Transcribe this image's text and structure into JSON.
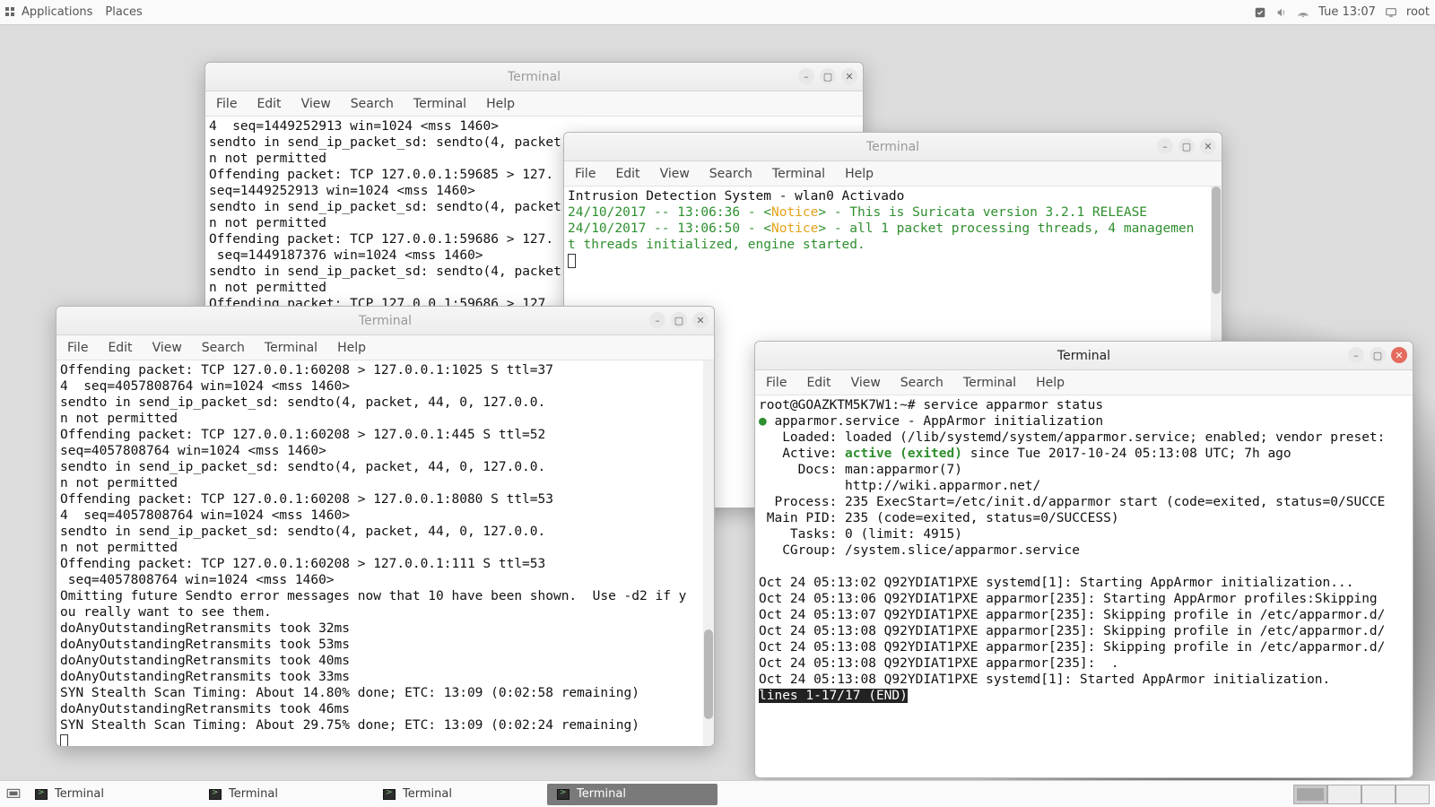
{
  "top": {
    "applications": "Applications",
    "places": "Places",
    "clock": "Tue 13:07",
    "user": "root"
  },
  "bottom": {
    "tasks": [
      "Terminal",
      "Terminal",
      "Terminal",
      "Terminal"
    ],
    "active_index": 3
  },
  "menus": {
    "file": "File",
    "edit": "Edit",
    "view": "View",
    "search": "Search",
    "terminal": "Terminal",
    "help": "Help"
  },
  "win1": {
    "title": "Terminal",
    "body": "4  seq=1449252913 win=1024 <mss 1460>\nsendto in send_ip_packet_sd: sendto(4, packet\nn not permitted\nOffending packet: TCP 127.0.0.1:59685 > 127.\nseq=1449252913 win=1024 <mss 1460>\nsendto in send_ip_packet_sd: sendto(4, packet\nn not permitted\nOffending packet: TCP 127.0.0.1:59686 > 127.\n seq=1449187376 win=1024 <mss 1460>\nsendto in send_ip_packet_sd: sendto(4, packet\nn not permitted\nOffending packet: TCP 127.0.0.1:59686 > 127."
  },
  "win2": {
    "title": "Terminal",
    "line0": "Intrusion Detection System - wlan0 Activado",
    "ts1": "24/10/2017 -- 13:06:36 - <",
    "ts2": "24/10/2017 -- 13:06:50 - <",
    "notice": "Notice",
    "msg1": "This is Suricata version 3.2.1 RELEASE",
    "msg2a": "all 1 packet processing threads, 4 managemen",
    "msg2b": "t threads initialized, engine started."
  },
  "win3": {
    "title": "Terminal",
    "body": "Offending packet: TCP 127.0.0.1:60208 > 127.0.0.1:1025 S ttl=37\n4  seq=4057808764 win=1024 <mss 1460>\nsendto in send_ip_packet_sd: sendto(4, packet, 44, 0, 127.0.0.\nn not permitted\nOffending packet: TCP 127.0.0.1:60208 > 127.0.0.1:445 S ttl=52\nseq=4057808764 win=1024 <mss 1460>\nsendto in send_ip_packet_sd: sendto(4, packet, 44, 0, 127.0.0.\nn not permitted\nOffending packet: TCP 127.0.0.1:60208 > 127.0.0.1:8080 S ttl=53\n4  seq=4057808764 win=1024 <mss 1460>\nsendto in send_ip_packet_sd: sendto(4, packet, 44, 0, 127.0.0.\nn not permitted\nOffending packet: TCP 127.0.0.1:60208 > 127.0.0.1:111 S ttl=53\n seq=4057808764 win=1024 <mss 1460>\nOmitting future Sendto error messages now that 10 have been shown.  Use -d2 if y\nou really want to see them.\ndoAnyOutstandingRetransmits took 32ms\ndoAnyOutstandingRetransmits took 53ms\ndoAnyOutstandingRetransmits took 40ms\ndoAnyOutstandingRetransmits took 33ms\nSYN Stealth Scan Timing: About 14.80% done; ETC: 13:09 (0:02:58 remaining)\ndoAnyOutstandingRetransmits took 46ms\nSYN Stealth Scan Timing: About 29.75% done; ETC: 13:09 (0:02:24 remaining)"
  },
  "win4": {
    "title": "Terminal",
    "prompt": "root@GOAZKTM5K7W1:~# service apparmor status",
    "svc_name": "apparmor.service - AppArmor initialization",
    "loaded": "   Loaded: loaded (/lib/systemd/system/apparmor.service; enabled; vendor preset:",
    "active_pre": "   Active: ",
    "active_state": "active (exited)",
    "active_post": " since Tue 2017-10-24 05:13:08 UTC; 7h ago",
    "docs1": "     Docs: man:apparmor(7)",
    "docs2": "           http://wiki.apparmor.net/",
    "process": "  Process: 235 ExecStart=/etc/init.d/apparmor start (code=exited, status=0/SUCCE",
    "mainpid": " Main PID: 235 (code=exited, status=0/SUCCESS)",
    "tasks": "    Tasks: 0 (limit: 4915)",
    "cgroup": "   CGroup: /system.slice/apparmor.service",
    "log": "Oct 24 05:13:02 Q92YDIAT1PXE systemd[1]: Starting AppArmor initialization...\nOct 24 05:13:06 Q92YDIAT1PXE apparmor[235]: Starting AppArmor profiles:Skipping\nOct 24 05:13:07 Q92YDIAT1PXE apparmor[235]: Skipping profile in /etc/apparmor.d/\nOct 24 05:13:08 Q92YDIAT1PXE apparmor[235]: Skipping profile in /etc/apparmor.d/\nOct 24 05:13:08 Q92YDIAT1PXE apparmor[235]: Skipping profile in /etc/apparmor.d/\nOct 24 05:13:08 Q92YDIAT1PXE apparmor[235]:  .\nOct 24 05:13:08 Q92YDIAT1PXE systemd[1]: Started AppArmor initialization.",
    "pager": "lines 1-17/17 (END)"
  }
}
